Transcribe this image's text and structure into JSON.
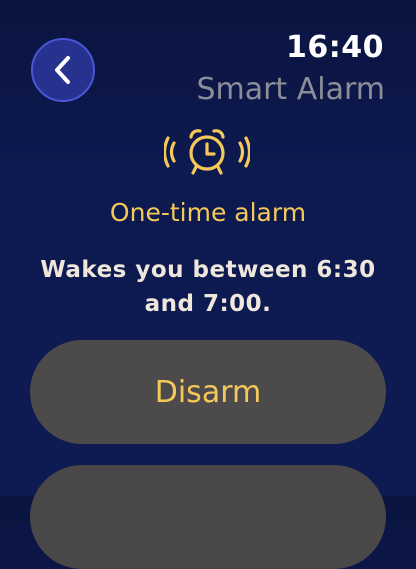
{
  "header": {
    "time": "16:40",
    "title": "Smart Alarm"
  },
  "icons": {
    "back": "chevron-left-icon",
    "alarm": "alarm-clock-ringing-icon"
  },
  "alarm": {
    "type": "One-time alarm",
    "description": "Wakes you between 6:30 and 7:00."
  },
  "actions": {
    "disarm_label": "Disarm"
  },
  "colors": {
    "accent": "#f5c85a",
    "background": "#0d1a50",
    "button": "#4d4a4c",
    "back_button": "#26328e"
  }
}
